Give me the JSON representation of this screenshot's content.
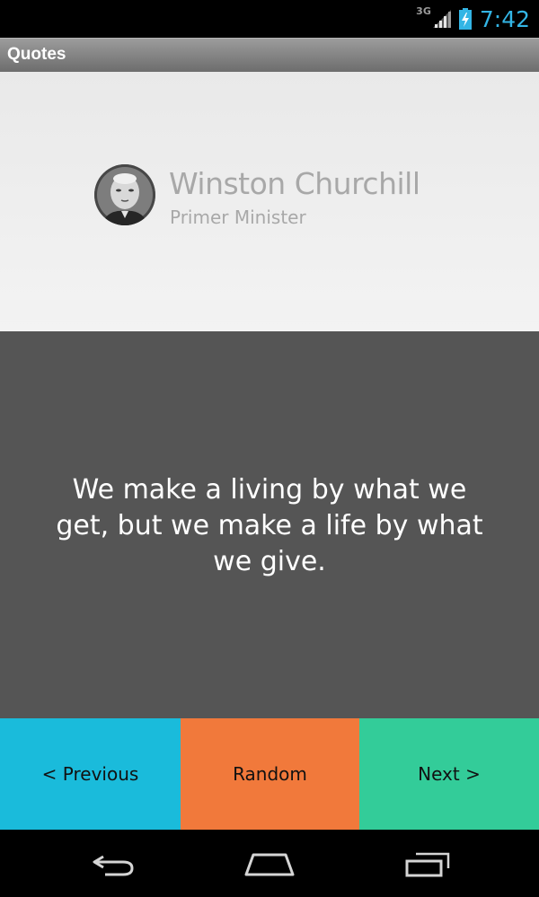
{
  "status_bar": {
    "network": "3G",
    "time": "7:42",
    "icons": [
      "signal-icon",
      "battery-charging-icon"
    ],
    "accent_color": "#33b5e5"
  },
  "action_bar": {
    "title": "Quotes"
  },
  "author": {
    "name": "Winston Churchill",
    "role": "Primer Minister",
    "avatar_icon": "avatar-portrait"
  },
  "quote": {
    "text": "We make a living by what we get, but we make a life by what we give."
  },
  "buttons": {
    "previous": {
      "label": "< Previous",
      "color": "#1abbdb"
    },
    "random": {
      "label": "Random",
      "color": "#f1793b"
    },
    "next": {
      "label": "Next >",
      "color": "#33cc99"
    }
  },
  "system_nav": {
    "icons": [
      "back-icon",
      "home-icon",
      "recent-apps-icon"
    ]
  }
}
